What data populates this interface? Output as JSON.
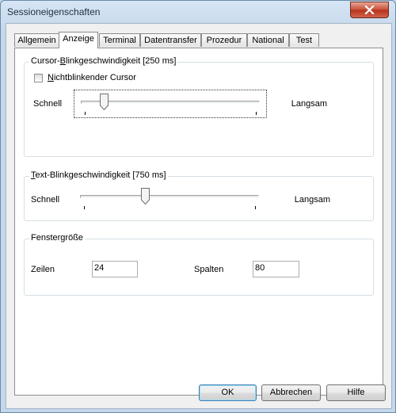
{
  "window": {
    "title": "Sessioneigenschaften"
  },
  "tabs": [
    {
      "label": "Allgemein"
    },
    {
      "label": "Anzeige"
    },
    {
      "label": "Terminal"
    },
    {
      "label": "Datentransfer"
    },
    {
      "label": "Prozedur"
    },
    {
      "label": "National"
    },
    {
      "label": "Test"
    }
  ],
  "active_tab": "Anzeige",
  "cursor_blink": {
    "title": "Cursor-Blinkgeschwindigkeit [250 ms]",
    "checkbox_label": "Nichtblinkender Cursor",
    "checked": false,
    "left_label": "Schnell",
    "right_label": "Langsam",
    "slider_value": 0.11
  },
  "text_blink": {
    "title": "Text-Blinkgeschwindigkeit [750 ms]",
    "left_label": "Schnell",
    "right_label": "Langsam",
    "slider_value": 0.36
  },
  "window_size": {
    "title": "Fenstergröße",
    "rows_label": "Zeilen",
    "rows_value": "24",
    "cols_label": "Spalten",
    "cols_value": "80"
  },
  "buttons": {
    "ok": "OK",
    "cancel": "Abbrechen",
    "help": "Hilfe"
  }
}
